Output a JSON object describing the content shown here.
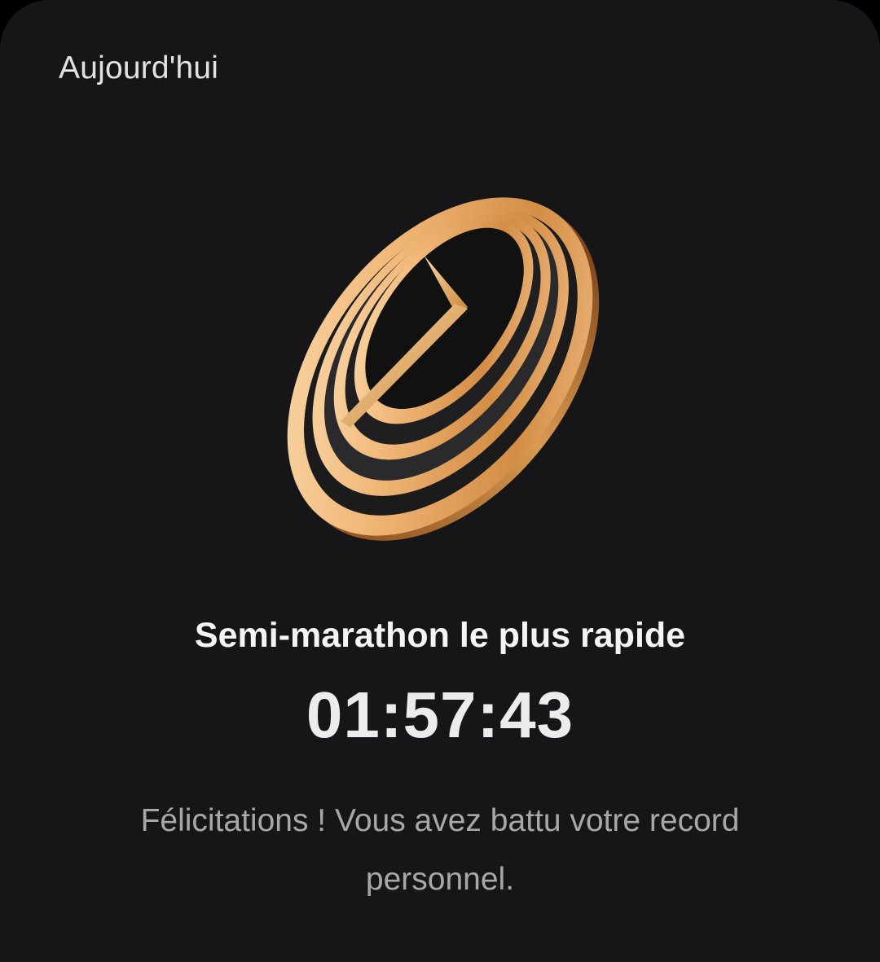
{
  "card": {
    "date_label": "Aujourd'hui",
    "medal_icon": "gold-stopwatch-rings-icon",
    "record_title": "Semi-marathon le plus rapide",
    "record_time": "01:57:43",
    "message": "Félicitations ! Vous avez battu votre record personnel."
  },
  "colors": {
    "background": "#161618",
    "gold_light": "#f7c99a",
    "gold_mid": "#e0a25e",
    "gold_dark": "#9a5e24",
    "text_primary": "#f4f4f4",
    "text_secondary": "#a8a8aa"
  }
}
